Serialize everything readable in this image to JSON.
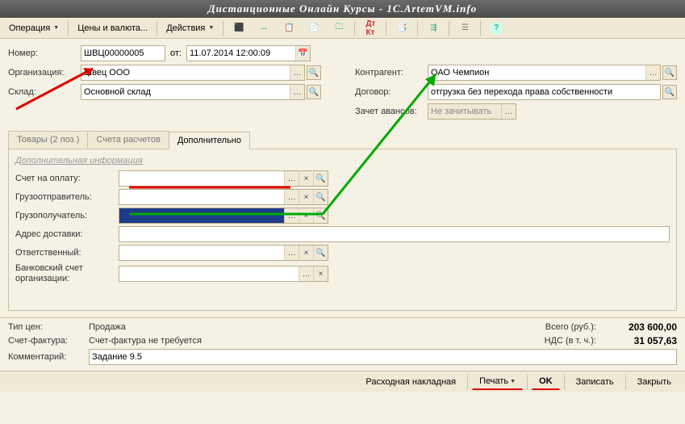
{
  "title": "Дистанционные Онлайн Курсы - 1C.ArtemVM.info",
  "toolbar": {
    "operation": "Операция",
    "prices": "Цены и валюта...",
    "actions": "Действия"
  },
  "header": {
    "number_label": "Номер:",
    "number": "ШВЦ00000005",
    "from_label": "от:",
    "date": "11.07.2014 12:00:09",
    "org_label": "Организация:",
    "org": "Швец ООО",
    "warehouse_label": "Склад:",
    "warehouse": "Основной склад",
    "contragent_label": "Контрагент:",
    "contragent": "ОАО Чемпион",
    "contract_label": "Договор:",
    "contract": "отгрузка без перехода права собственности",
    "advance_label": "Зачет авансов:",
    "advance": "Не зачитывать"
  },
  "tabs": {
    "goods": "Товары (2 поз.)",
    "accounts": "Счета расчетов",
    "additional": "Дополнительно"
  },
  "additional": {
    "section": "Дополнительная информация",
    "invoice_label": "Счет на оплату:",
    "shipper_label": "Грузоотправитель:",
    "consignee_label": "Грузополучатель:",
    "address_label": "Адрес доставки:",
    "responsible_label": "Ответственный:",
    "bankacct_label": "Банковский счет организации:"
  },
  "footer": {
    "price_type_label": "Тип цен:",
    "price_type": "Продажа",
    "invoice_label": "Счет-фактура:",
    "invoice": "Счет-фактура не требуется",
    "comment_label": "Комментарий:",
    "comment": "Задание 9.5",
    "total_label": "Всего (руб.):",
    "total": "203 600,00",
    "vat_label": "НДС (в т. ч.):",
    "vat": "31 057,63"
  },
  "bottom": {
    "waybill": "Расходная накладная",
    "print": "Печать",
    "ok": "OK",
    "save": "Записать",
    "close": "Закрыть"
  }
}
